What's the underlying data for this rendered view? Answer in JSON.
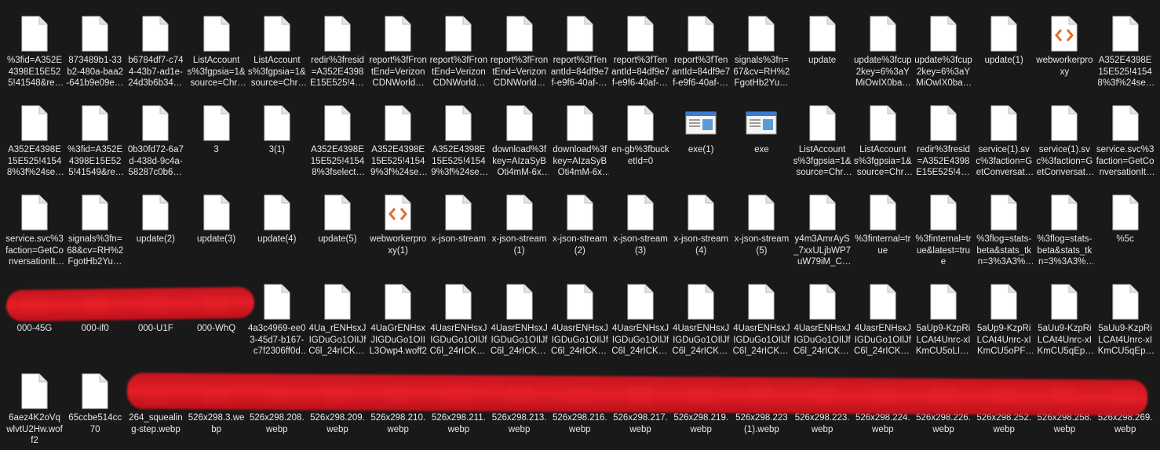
{
  "window": {
    "title": ""
  },
  "colors": {
    "background": "#191919",
    "text": "#e8e8e8",
    "redaction": "#e0202a",
    "code_icon_accent": "#e07030"
  },
  "files": [
    {
      "label": "%3fid=A352E4398E15E525!41548&resid=A3…",
      "icon": "doc-icon"
    },
    {
      "label": "873489b1-33b2-480a-baa2-641b9e09edcd%…",
      "icon": "doc-icon"
    },
    {
      "label": "b6784df7-c744-43b7-ad1e-24d3b6b3457d…",
      "icon": "doc-icon"
    },
    {
      "label": "ListAccounts%3fgpsia=1&source=Chromi…",
      "icon": "doc-icon"
    },
    {
      "label": "ListAccounts%3fgpsia=1&source=Chromi…",
      "icon": "doc-icon"
    },
    {
      "label": "redir%3fresid=A352E4398E15E525!41548&a…",
      "icon": "doc-icon"
    },
    {
      "label": "report%3fFrontEnd=VerizonCDNWorldWi…",
      "icon": "doc-icon"
    },
    {
      "label": "report%3fFrontEnd=VerizonCDNWorldWi…",
      "icon": "doc-icon"
    },
    {
      "label": "report%3fFrontEnd=VerizonCDNWorldWi…",
      "icon": "doc-icon"
    },
    {
      "label": "report%3fTenantId=84df9e7f-e9f6-40af-b43…",
      "icon": "doc-icon"
    },
    {
      "label": "report%3fTenantId=84df9e7f-e9f6-40af-b43…",
      "icon": "doc-icon"
    },
    {
      "label": "report%3fTenantId=84df9e7f-e9f6-40af-b43…",
      "icon": "doc-icon"
    },
    {
      "label": "signals%3fn=67&cv=RH%2FgotHb2Yuv2r…",
      "icon": "doc-icon"
    },
    {
      "label": "update",
      "icon": "doc-icon"
    },
    {
      "label": "update%3fcup2key=6%3aYMiOwIX0baLrd…",
      "icon": "doc-icon"
    },
    {
      "label": "update%3fcup2key=6%3aYMiOwIX0baLrd…",
      "icon": "doc-icon"
    },
    {
      "label": "update(1)",
      "icon": "doc-icon"
    },
    {
      "label": "webworkerproxy",
      "icon": "code-icon"
    },
    {
      "label": "A352E4398E15E525!41548%3f%24select=%…",
      "icon": "doc-icon"
    },
    {
      "label": "A352E4398E15E525!41548%3f%24select=%…",
      "icon": "doc-icon"
    },
    {
      "label": "%3fid=A352E4398E15E525!41549&resid=A3…",
      "icon": "doc-icon"
    },
    {
      "label": "0b30fd72-6a7d-438d-9c4a-58287c0b67da%…",
      "icon": "doc-icon"
    },
    {
      "label": "3",
      "icon": "doc-icon"
    },
    {
      "label": "3(1)",
      "icon": "doc-icon"
    },
    {
      "label": "A352E4398E15E525!41548%3fselect=id%2C…",
      "icon": "doc-icon"
    },
    {
      "label": "A352E4398E15E525!41549%3f%24select=%…",
      "icon": "doc-icon"
    },
    {
      "label": "A352E4398E15E525!41549%3f%24select=%…",
      "icon": "doc-icon"
    },
    {
      "label": "download%3fkey=AIzaSyBOti4mM-6x9…",
      "icon": "doc-icon"
    },
    {
      "label": "download%3fkey=AIzaSyBOti4mM-6x9…",
      "icon": "doc-icon"
    },
    {
      "label": "en-gb%3fbucketId=0",
      "icon": "doc-icon"
    },
    {
      "label": "exe(1)",
      "icon": "exe-icon"
    },
    {
      "label": "exe",
      "icon": "exe-icon"
    },
    {
      "label": "ListAccounts%3fgpsia=1&source=Chromi…",
      "icon": "doc-icon"
    },
    {
      "label": "ListAccounts%3fgpsia=1&source=Chromi…",
      "icon": "doc-icon"
    },
    {
      "label": "redir%3fresid=A352E4398E15E525!41549&a…",
      "icon": "doc-icon"
    },
    {
      "label": "service(1).svc%3faction=GetConversationIt…",
      "icon": "doc-icon"
    },
    {
      "label": "service(1).svc%3faction=GetConversationIt…",
      "icon": "doc-icon"
    },
    {
      "label": "service.svc%3faction=GetConversationItem…",
      "icon": "doc-icon"
    },
    {
      "label": "service.svc%3faction=GetConversationItem…",
      "icon": "doc-icon"
    },
    {
      "label": "signals%3fn=68&cv=RH%2FgotHb2Yuv2r…",
      "icon": "doc-icon"
    },
    {
      "label": "update(2)",
      "icon": "doc-icon"
    },
    {
      "label": "update(3)",
      "icon": "doc-icon"
    },
    {
      "label": "update(4)",
      "icon": "doc-icon"
    },
    {
      "label": "update(5)",
      "icon": "doc-icon"
    },
    {
      "label": "webworkerproxy(1)",
      "icon": "code-icon"
    },
    {
      "label": "x-json-stream",
      "icon": "doc-icon"
    },
    {
      "label": "x-json-stream(1)",
      "icon": "doc-icon"
    },
    {
      "label": "x-json-stream(2)",
      "icon": "doc-icon"
    },
    {
      "label": "x-json-stream(3)",
      "icon": "doc-icon"
    },
    {
      "label": "x-json-stream(4)",
      "icon": "doc-icon"
    },
    {
      "label": "x-json-stream(5)",
      "icon": "doc-icon"
    },
    {
      "label": "y4m3AmrAyS_7xxULjbWP7uW79iM_CuWx…",
      "icon": "doc-icon"
    },
    {
      "label": "%3finternal=true",
      "icon": "doc-icon"
    },
    {
      "label": "%3finternal=true&latest=true",
      "icon": "doc-icon"
    },
    {
      "label": "%3flog=stats-beta&stats_tkn=3%3A3%3A1…",
      "icon": "doc-icon"
    },
    {
      "label": "%3flog=stats-beta&stats_tkn=3%3A3%3A1…",
      "icon": "doc-icon"
    },
    {
      "label": "%5c",
      "icon": "doc-icon"
    },
    {
      "label": "000-45G",
      "icon": "image-thumb"
    },
    {
      "label": "000-if0",
      "icon": "image-thumb"
    },
    {
      "label": "000-U1F",
      "icon": "image-thumb"
    },
    {
      "label": "000-WhQ",
      "icon": "image-thumb"
    },
    {
      "label": "4a3c4969-ee03-45d7-b167-c7f2306ff0d1%3…",
      "icon": "doc-icon"
    },
    {
      "label": "4Ua_rENHsxJIGDuGo1OIIJfC6l_24rICK1Yo_Iq…",
      "icon": "doc-icon"
    },
    {
      "label": "4UaGrENHsxJIGDuGo1OIIL3Owp4.woff2",
      "icon": "doc-icon"
    },
    {
      "label": "4UasrENHsxJIGDuGo1OIlJfC6l_24rICK1Yo_Iq…",
      "icon": "doc-icon"
    },
    {
      "label": "4UasrENHsxJIGDuGo1OIlJfC6l_24rICK1Yo_Iq…",
      "icon": "doc-icon"
    },
    {
      "label": "4UasrENHsxJIGDuGo1OIlJfC6l_24rICK1Yo_Iq…",
      "icon": "doc-icon"
    },
    {
      "label": "4UasrENHsxJIGDuGo1OIlJfC6l_24rICK1Yo_Iq…",
      "icon": "doc-icon"
    },
    {
      "label": "4UasrENHsxJIGDuGo1OIlJfC6l_24rICK1Yo_Iq…",
      "icon": "doc-icon"
    },
    {
      "label": "4UasrENHsxJIGDuGo1OIlJfC6l_24rICK1Yo_Iq…",
      "icon": "doc-icon"
    },
    {
      "label": "4UasrENHsxJIGDuGo1OIlJfC6l_24rICK1Yo_Iq…",
      "icon": "doc-icon"
    },
    {
      "label": "4UasrENHsxJIGDuGo1OIlJfC6l_24rICK1Yo_Iq…",
      "icon": "doc-icon"
    },
    {
      "label": "5aUp9-KzpRiLCAt4Unrc-xIKmCU5oLIVnmhj…",
      "icon": "doc-icon"
    },
    {
      "label": "5aUp9-KzpRiLCAt4Unrc-xIKmCU5oPFTnmh…",
      "icon": "doc-icon"
    },
    {
      "label": "5aUu9-KzpRiLCAt4Unrc-xIKmCU5qEp2iw(1)…",
      "icon": "doc-icon"
    },
    {
      "label": "5aUu9-KzpRiLCAt4Unrc-xIKmCU5qEp2iw.w…",
      "icon": "doc-icon"
    },
    {
      "label": "6aez4K2oVqwlvtU2Hw.woff2",
      "icon": "doc-icon"
    },
    {
      "label": "65ccbe514cc70",
      "icon": "doc-icon"
    },
    {
      "label": "264_squealing-step.webp",
      "icon": "image-thumb"
    },
    {
      "label": "526x298.3.webp",
      "icon": "image-thumb"
    },
    {
      "label": "526x298.208.webp",
      "icon": "image-thumb"
    },
    {
      "label": "526x298.209.webp",
      "icon": "image-thumb"
    },
    {
      "label": "526x298.210.webp",
      "icon": "image-thumb"
    },
    {
      "label": "526x298.211.webp",
      "icon": "image-thumb"
    },
    {
      "label": "526x298.213.webp",
      "icon": "image-thumb"
    },
    {
      "label": "526x298.216.webp",
      "icon": "image-thumb"
    },
    {
      "label": "526x298.217.webp",
      "icon": "image-thumb"
    },
    {
      "label": "526x298.219.webp",
      "icon": "image-thumb"
    },
    {
      "label": "526x298.223(1).webp",
      "icon": "image-thumb"
    },
    {
      "label": "526x298.223.webp",
      "icon": "image-thumb"
    },
    {
      "label": "526x298.224.webp",
      "icon": "image-thumb"
    },
    {
      "label": "526x298.226.webp",
      "icon": "image-thumb"
    },
    {
      "label": "526x298.252.webp",
      "icon": "image-thumb"
    },
    {
      "label": "526x298.258.webp",
      "icon": "image-thumb"
    },
    {
      "label": "526x298.269.webp",
      "icon": "image-thumb"
    }
  ]
}
